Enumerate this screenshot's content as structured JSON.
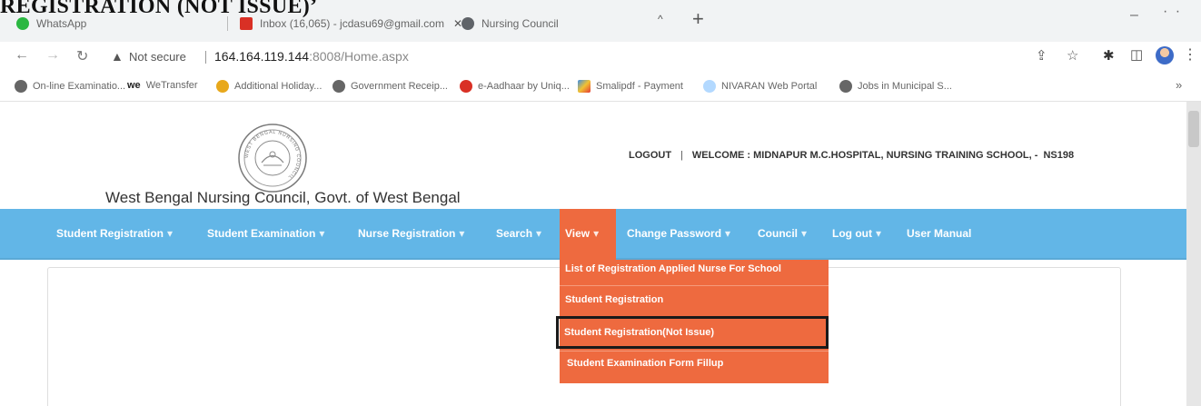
{
  "document": {
    "heading": "REGISTRATION (NOT ISSUE)’"
  },
  "browser": {
    "tabs": [
      {
        "title": "WhatsApp"
      },
      {
        "title": "Inbox (16,065) - jcdasu69@gmail.com"
      },
      {
        "title": "Nursing Council"
      }
    ],
    "address": {
      "security_label": "Not secure",
      "url_host": "164.164.119.144",
      "url_port": ":8008",
      "url_path": "/Home.aspx"
    },
    "bookmarks": [
      {
        "label": "On-line Examinatio..."
      },
      {
        "label": "WeTransfer",
        "icon_text": "we"
      },
      {
        "label": "Additional Holiday..."
      },
      {
        "label": "Government Receip..."
      },
      {
        "label": "e-Aadhaar by Uniq..."
      },
      {
        "label": "Smalipdf - Payment"
      },
      {
        "label": "NIVARAN Web Portal"
      },
      {
        "label": "Jobs in Municipal S..."
      }
    ],
    "bookmarks_more": "»"
  },
  "site": {
    "council_name": "West Bengal Nursing Council, Govt. of West Bengal",
    "seal_ring_text": "WEST BENGAL NURSING COUNCIL",
    "top_nav": {
      "logout": "LOGOUT",
      "separator": "|",
      "welcome": "WELCOME : MIDNAPUR M.C.HOSPITAL, NURSING TRAINING SCHOOL, -",
      "code": "NS198"
    },
    "menu": [
      {
        "label": "Student Registration",
        "caret": "▾"
      },
      {
        "label": "Student Examination",
        "caret": "▾"
      },
      {
        "label": "Nurse Registration",
        "caret": "▾"
      },
      {
        "label": "Search",
        "caret": "▾"
      },
      {
        "label": "View",
        "caret": "▾"
      },
      {
        "label": "Change Password",
        "caret": "▾"
      },
      {
        "label": "Council",
        "caret": "▾"
      },
      {
        "label": "Log out",
        "caret": "▾"
      },
      {
        "label": "User Manual",
        "caret": ""
      }
    ],
    "view_dropdown": [
      {
        "label": "List of Registration Applied Nurse For School"
      },
      {
        "label": "Student Registration"
      },
      {
        "label": "Student Registration(Not Issue)"
      },
      {
        "label": "Student Examination Form Fillup"
      }
    ],
    "highlighted_item": "Student Registration(Not Issue)"
  },
  "colors": {
    "menubar": "#62b6e7",
    "active_menu": "#ee6a3f",
    "highlight_border": "#1a1a1a"
  },
  "icons": {
    "back": "arrow-left-icon",
    "forward": "arrow-right-icon",
    "reload": "reload-icon",
    "security": "warning-triangle-icon",
    "share": "share-icon",
    "bookmark_star": "star-icon",
    "extensions": "puzzle-icon",
    "side_panel": "side-panel-icon",
    "menu": "kebab-menu-icon"
  }
}
